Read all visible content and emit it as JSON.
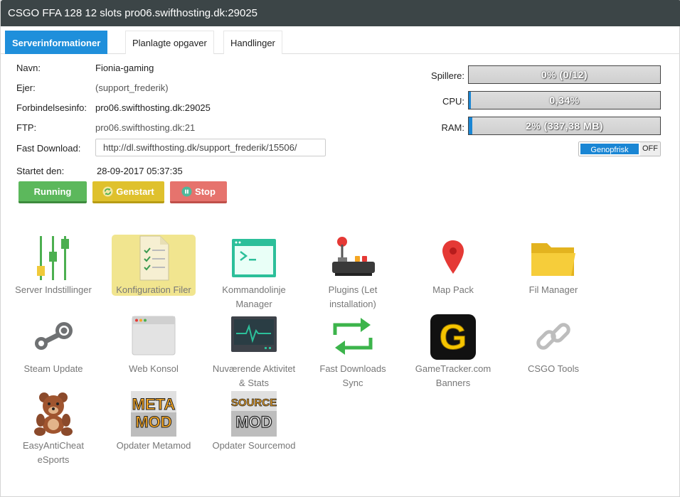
{
  "window": {
    "title": "CSGO FFA 128 12 slots pro06.swifthosting.dk:29025"
  },
  "tabs": [
    {
      "label": "Serverinformationer"
    },
    {
      "label": "Planlagte opgaver"
    },
    {
      "label": "Handlinger"
    }
  ],
  "info": {
    "name_label": "Navn:",
    "name_value": "Fionia-gaming",
    "owner_label": "Ejer:",
    "owner_value": "(support_frederik)",
    "conn_label": "Forbindelsesinfo:",
    "conn_value": "pro06.swifthosting.dk:29025",
    "ftp_label": "FTP:",
    "ftp_value": "pro06.swifthosting.dk:21",
    "fd_label": "Fast Download:",
    "fd_value": "http://dl.swifthosting.dk/support_frederik/15506/",
    "started_label": "Startet den:",
    "started_value": "28-09-2017 05:37:35"
  },
  "buttons": {
    "running": "Running",
    "restart": "Genstart",
    "stop": "Stop"
  },
  "stats": {
    "players_label": "Spillere:",
    "players_text": "0% (0/12)",
    "players_fraction": 0.0,
    "cpu_label": "CPU:",
    "cpu_text": "0,34%",
    "cpu_fraction": 0.0034,
    "ram_label": "RAM:",
    "ram_text": "2% (337,38 MB)",
    "ram_fraction": 0.02,
    "refresh_on": "Genopfrisk",
    "refresh_off": "OFF"
  },
  "tools": [
    {
      "label": "Server Indstillinger",
      "icon": "sliders-icon"
    },
    {
      "label": "Konfiguration Filer",
      "icon": "config-file-icon"
    },
    {
      "label": "Kommandolinje Manager",
      "icon": "terminal-icon"
    },
    {
      "label": "Plugins (Let installation)",
      "icon": "joystick-icon"
    },
    {
      "label": "Map Pack",
      "icon": "map-pin-icon"
    },
    {
      "label": "Fil Manager",
      "icon": "folder-icon"
    },
    {
      "label": "Steam Update",
      "icon": "steam-icon"
    },
    {
      "label": "Web Konsol",
      "icon": "browser-window-icon"
    },
    {
      "label": "Nuværende Aktivitet & Stats",
      "icon": "monitor-activity-icon"
    },
    {
      "label": "Fast Downloads Sync",
      "icon": "sync-arrows-icon"
    },
    {
      "label": "GameTracker.com Banners",
      "icon": "gametracker-icon"
    },
    {
      "label": "CSGO Tools",
      "icon": "chain-link-icon"
    },
    {
      "label": "EasyAntiCheat eSports",
      "icon": "teddy-bear-icon"
    },
    {
      "label": "Opdater Metamod",
      "icon": "metamod-icon"
    },
    {
      "label": "Opdater Sourcemod",
      "icon": "sourcemod-icon"
    }
  ],
  "logo_text": {
    "gametracker": "G",
    "metamod": [
      "META",
      "MOD"
    ],
    "sourcemod": [
      "SOURCE",
      "MOD"
    ]
  },
  "colors": {
    "accent": "#1f8fdb",
    "running": "#5cb85c",
    "restart": "#dfc12d",
    "stop": "#e6736d",
    "active_tile": "#f1e58f"
  }
}
